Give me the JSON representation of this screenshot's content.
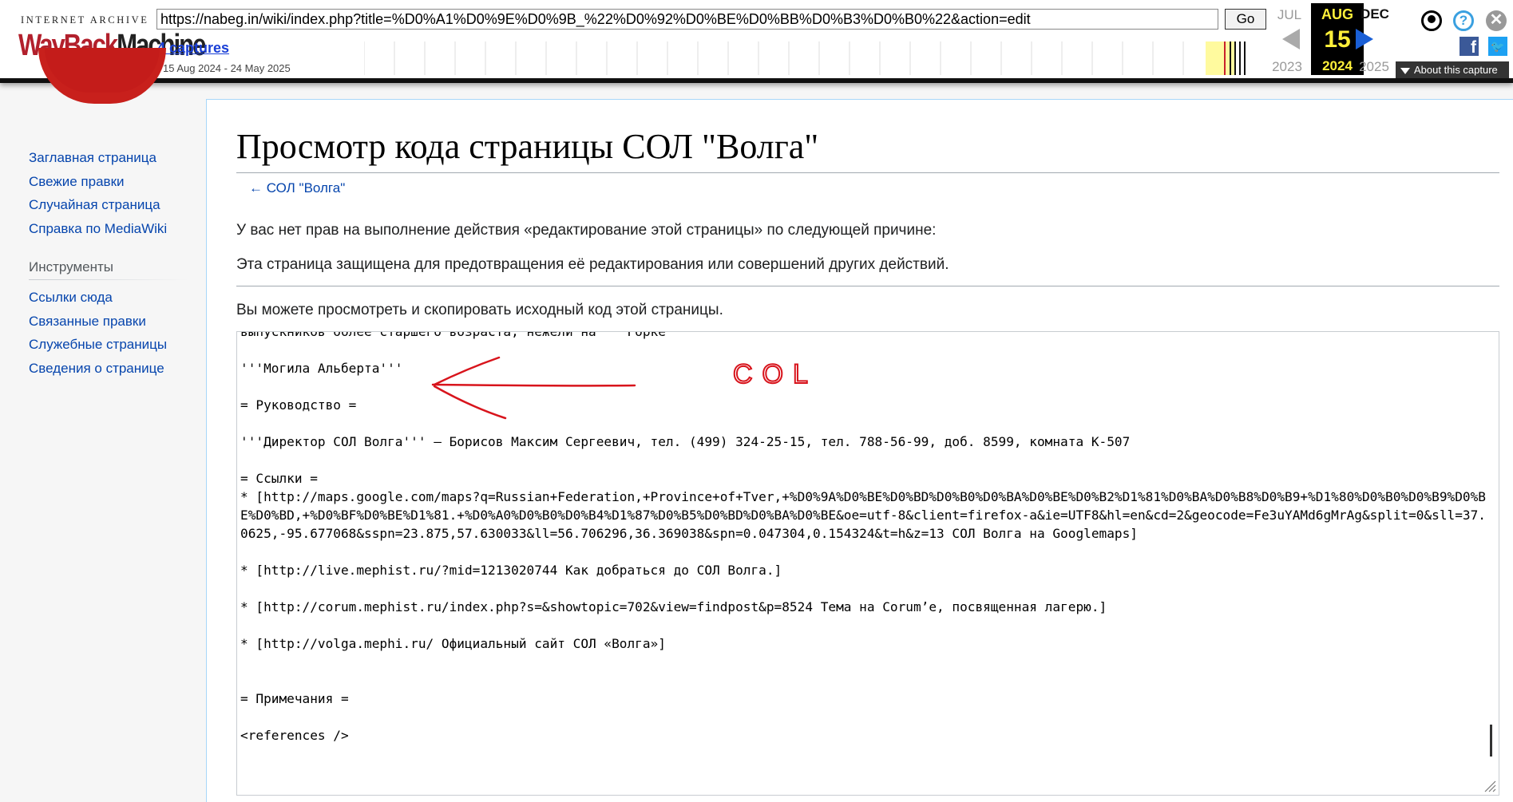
{
  "wayback": {
    "logo_top": "INTERNET ARCHIVE",
    "logo_wayback": "WayBack",
    "logo_machine": "Machine",
    "url": "https://nabeg.in/wiki/index.php?title=%D0%A1%D0%9E%D0%9B_%22%D0%92%D0%BE%D0%BB%D0%B3%D0%B0%22&action=edit",
    "go_label": "Go",
    "captures_label": "4 captures",
    "date_range": "15 Aug 2024 - 24 May 2025",
    "prev_month": "JUL",
    "cur_month": "AUG",
    "cur_day": "15",
    "cur_year": "2024",
    "next_month": "DEC",
    "prev_year": "2023",
    "next_year": "2025",
    "about_label": "About this capture",
    "help_glyph": "?",
    "close_glyph": "✕",
    "fb_glyph": "f",
    "tw_glyph": "🐦",
    "colors": {
      "accent_yellow": "#fff03a",
      "link_blue": "#1a3fd6"
    }
  },
  "sidebar": {
    "nav": [
      {
        "label": "Заглавная страница"
      },
      {
        "label": "Свежие правки"
      },
      {
        "label": "Случайная страница"
      },
      {
        "label": "Справка по MediaWiki"
      }
    ],
    "tools_heading": "Инструменты",
    "tools": [
      {
        "label": "Ссылки сюда"
      },
      {
        "label": "Связанные правки"
      },
      {
        "label": "Служебные страницы"
      },
      {
        "label": "Сведения о странице"
      }
    ]
  },
  "content": {
    "title": "Просмотр кода страницы СОЛ \"Волга\"",
    "back_link": "← СОЛ \"Волга\"",
    "no_rights": "У вас нет прав на выполнение действия «редактирование этой страницы» по следующей причине:",
    "protected": "Эта страница защищена для предотвращения её редактирования или совершений других действий.",
    "view_copy": "Вы можете просмотреть и скопировать исходный код этой страницы.",
    "source_code": "выпускников более старшего возраста, нежели на '''Горке'''\n\n'''Могила Альберта'''\n\n= Руководство =\n\n'''Директор СОЛ Волга''' — Борисов Максим Сергеевич, тел. (499) 324-25-15, тел. 788-56-99, доб. 8599, комната К-507\n\n= Ссылки =\n* [http://maps.google.com/maps?q=Russian+Federation,+Province+of+Tver,+%D0%9A%D0%BE%D0%BD%D0%B0%D0%BA%D0%BE%D0%B2%D1%81%D0%BA%D0%B8%D0%B9+%D1%80%D0%B0%D0%B9%D0%BE%D0%BD,+%D0%BF%D0%BE%D1%81.+%D0%A0%D0%B0%D0%B4%D1%87%D0%B5%D0%BD%D0%BA%D0%BE&oe=utf-8&client=firefox-a&ie=UTF8&hl=en&cd=2&geocode=Fe3uYAMd6gMrAg&split=0&sll=37.0625,-95.677068&sspn=23.875,57.630033&ll=56.706296,36.369038&spn=0.047304,0.154324&t=h&z=13 СОЛ Волга на Googlemaps]\n\n* [http://live.mephist.ru/?mid=1213020744 Как добраться до СОЛ Волга.]\n\n* [http://corum.mephist.ru/index.php?s=&showtopic=702&view=findpost&p=8524 Тема на Corum’е, посвященная лагерю.]\n\n* [http://volga.mephi.ru/ Официальный сайт СОЛ «Волга»]\n\n\n= Примечания =\n\n<references />",
    "annotation_text": "COL",
    "colors": {
      "annotation": "#d8141c",
      "link": "#0645ad"
    }
  }
}
